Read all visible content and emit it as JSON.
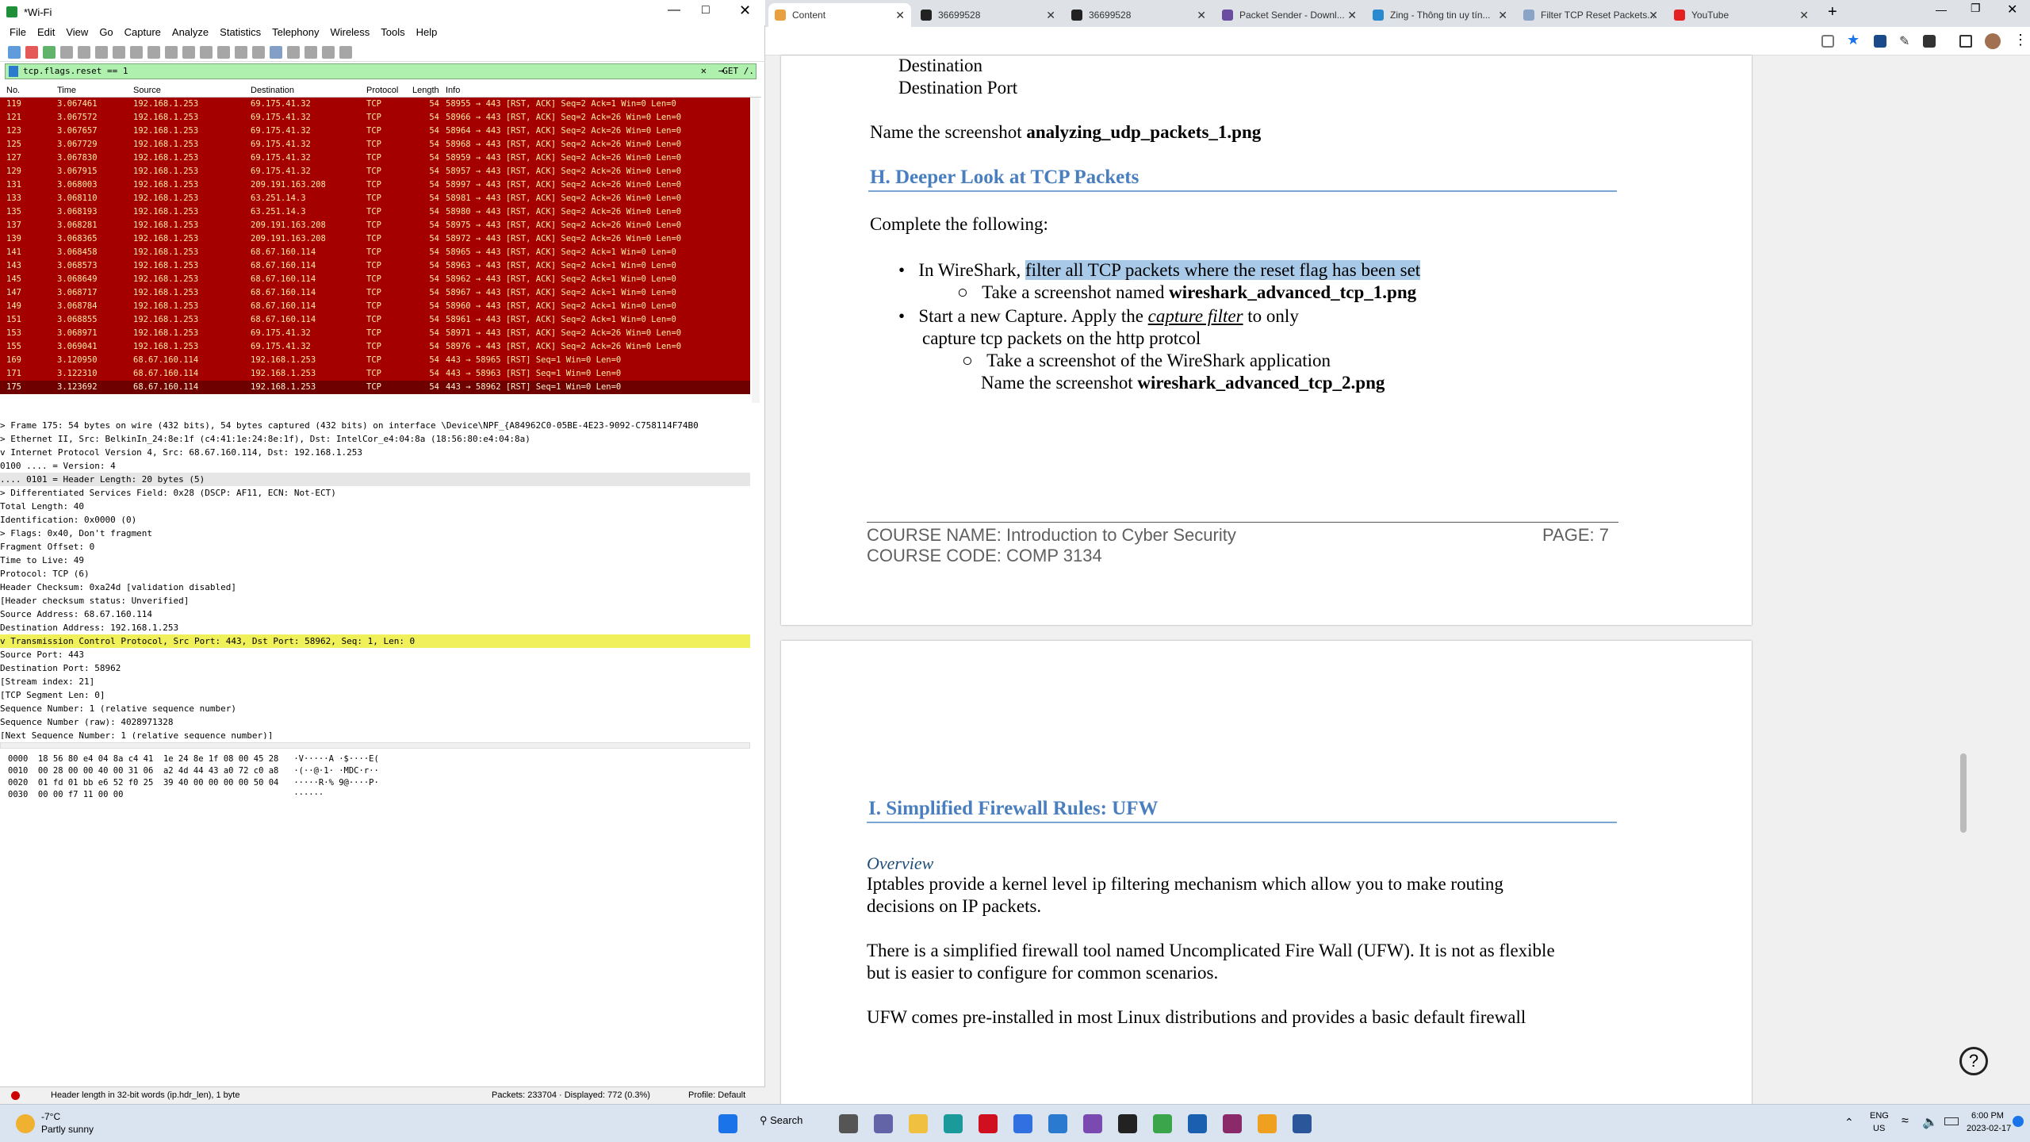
{
  "wireshark": {
    "title": "*Wi-Fi",
    "menu": [
      "File",
      "Edit",
      "View",
      "Go",
      "Capture",
      "Analyze",
      "Statistics",
      "Telephony",
      "Wireless",
      "Tools",
      "Help"
    ],
    "filter_value": "tcp.flags.reset == 1",
    "filter_expr": "GET /.",
    "columns": [
      "No.",
      "Time",
      "Source",
      "Destination",
      "Protocol",
      "Length",
      "Info"
    ],
    "packets": [
      [
        "119",
        "3.067461",
        "192.168.1.253",
        "69.175.41.32",
        "TCP",
        "54",
        "58955 → 443 [RST, ACK] Seq=2 Ack=1 Win=0 Len=0"
      ],
      [
        "121",
        "3.067572",
        "192.168.1.253",
        "69.175.41.32",
        "TCP",
        "54",
        "58966 → 443 [RST, ACK] Seq=2 Ack=26 Win=0 Len=0"
      ],
      [
        "123",
        "3.067657",
        "192.168.1.253",
        "69.175.41.32",
        "TCP",
        "54",
        "58964 → 443 [RST, ACK] Seq=2 Ack=26 Win=0 Len=0"
      ],
      [
        "125",
        "3.067729",
        "192.168.1.253",
        "69.175.41.32",
        "TCP",
        "54",
        "58968 → 443 [RST, ACK] Seq=2 Ack=26 Win=0 Len=0"
      ],
      [
        "127",
        "3.067830",
        "192.168.1.253",
        "69.175.41.32",
        "TCP",
        "54",
        "58959 → 443 [RST, ACK] Seq=2 Ack=26 Win=0 Len=0"
      ],
      [
        "129",
        "3.067915",
        "192.168.1.253",
        "69.175.41.32",
        "TCP",
        "54",
        "58957 → 443 [RST, ACK] Seq=2 Ack=26 Win=0 Len=0"
      ],
      [
        "131",
        "3.068003",
        "192.168.1.253",
        "209.191.163.208",
        "TCP",
        "54",
        "58997 → 443 [RST, ACK] Seq=2 Ack=26 Win=0 Len=0"
      ],
      [
        "133",
        "3.068110",
        "192.168.1.253",
        "63.251.14.3",
        "TCP",
        "54",
        "58981 → 443 [RST, ACK] Seq=2 Ack=26 Win=0 Len=0"
      ],
      [
        "135",
        "3.068193",
        "192.168.1.253",
        "63.251.14.3",
        "TCP",
        "54",
        "58980 → 443 [RST, ACK] Seq=2 Ack=26 Win=0 Len=0"
      ],
      [
        "137",
        "3.068281",
        "192.168.1.253",
        "209.191.163.208",
        "TCP",
        "54",
        "58975 → 443 [RST, ACK] Seq=2 Ack=26 Win=0 Len=0"
      ],
      [
        "139",
        "3.068365",
        "192.168.1.253",
        "209.191.163.208",
        "TCP",
        "54",
        "58972 → 443 [RST, ACK] Seq=2 Ack=26 Win=0 Len=0"
      ],
      [
        "141",
        "3.068458",
        "192.168.1.253",
        "68.67.160.114",
        "TCP",
        "54",
        "58965 → 443 [RST, ACK] Seq=2 Ack=1 Win=0 Len=0"
      ],
      [
        "143",
        "3.068573",
        "192.168.1.253",
        "68.67.160.114",
        "TCP",
        "54",
        "58963 → 443 [RST, ACK] Seq=2 Ack=1 Win=0 Len=0"
      ],
      [
        "145",
        "3.068649",
        "192.168.1.253",
        "68.67.160.114",
        "TCP",
        "54",
        "58962 → 443 [RST, ACK] Seq=2 Ack=1 Win=0 Len=0"
      ],
      [
        "147",
        "3.068717",
        "192.168.1.253",
        "68.67.160.114",
        "TCP",
        "54",
        "58967 → 443 [RST, ACK] Seq=2 Ack=1 Win=0 Len=0"
      ],
      [
        "149",
        "3.068784",
        "192.168.1.253",
        "68.67.160.114",
        "TCP",
        "54",
        "58960 → 443 [RST, ACK] Seq=2 Ack=1 Win=0 Len=0"
      ],
      [
        "151",
        "3.068855",
        "192.168.1.253",
        "68.67.160.114",
        "TCP",
        "54",
        "58961 → 443 [RST, ACK] Seq=2 Ack=1 Win=0 Len=0"
      ],
      [
        "153",
        "3.068971",
        "192.168.1.253",
        "69.175.41.32",
        "TCP",
        "54",
        "58971 → 443 [RST, ACK] Seq=2 Ack=26 Win=0 Len=0"
      ],
      [
        "155",
        "3.069041",
        "192.168.1.253",
        "69.175.41.32",
        "TCP",
        "54",
        "58976 → 443 [RST, ACK] Seq=2 Ack=26 Win=0 Len=0"
      ],
      [
        "169",
        "3.120950",
        "68.67.160.114",
        "192.168.1.253",
        "TCP",
        "54",
        "443 → 58965 [RST] Seq=1 Win=0 Len=0"
      ],
      [
        "171",
        "3.122310",
        "68.67.160.114",
        "192.168.1.253",
        "TCP",
        "54",
        "443 → 58963 [RST] Seq=1 Win=0 Len=0"
      ],
      [
        "175",
        "3.123692",
        "68.67.160.114",
        "192.168.1.253",
        "TCP",
        "54",
        "443 → 58962 [RST] Seq=1 Win=0 Len=0"
      ]
    ],
    "details": [
      {
        "t": "> Frame 175: 54 bytes on wire (432 bits), 54 bytes captured (432 bits) on interface \\Device\\NPF_{A84962C0-05BE-4E23-9092-C758114F74B0",
        "c": ""
      },
      {
        "t": "> Ethernet II, Src: BelkinIn_24:8e:1f (c4:41:1e:24:8e:1f), Dst: IntelCor_e4:04:8a (18:56:80:e4:04:8a)",
        "c": ""
      },
      {
        "t": "v Internet Protocol Version 4, Src: 68.67.160.114, Dst: 192.168.1.253",
        "c": ""
      },
      {
        "t": "    0100 .... = Version: 4",
        "c": ""
      },
      {
        "t": "    .... 0101 = Header Length: 20 bytes (5)",
        "c": "hl"
      },
      {
        "t": "  > Differentiated Services Field: 0x28 (DSCP: AF11, ECN: Not-ECT)",
        "c": ""
      },
      {
        "t": "    Total Length: 40",
        "c": ""
      },
      {
        "t": "    Identification: 0x0000 (0)",
        "c": ""
      },
      {
        "t": "  > Flags: 0x40, Don't fragment",
        "c": ""
      },
      {
        "t": "    Fragment Offset: 0",
        "c": ""
      },
      {
        "t": "    Time to Live: 49",
        "c": ""
      },
      {
        "t": "    Protocol: TCP (6)",
        "c": ""
      },
      {
        "t": "    Header Checksum: 0xa24d [validation disabled]",
        "c": ""
      },
      {
        "t": "    [Header checksum status: Unverified]",
        "c": ""
      },
      {
        "t": "    Source Address: 68.67.160.114",
        "c": ""
      },
      {
        "t": "    Destination Address: 192.168.1.253",
        "c": ""
      },
      {
        "t": "v Transmission Control Protocol, Src Port: 443, Dst Port: 58962, Seq: 1, Len: 0",
        "c": "ylw"
      },
      {
        "t": "    Source Port: 443",
        "c": ""
      },
      {
        "t": "    Destination Port: 58962",
        "c": ""
      },
      {
        "t": "    [Stream index: 21]",
        "c": ""
      },
      {
        "t": "    [TCP Segment Len: 0]",
        "c": ""
      },
      {
        "t": "    Sequence Number: 1    (relative sequence number)",
        "c": ""
      },
      {
        "t": "    Sequence Number (raw): 4028971328",
        "c": ""
      },
      {
        "t": "    [Next Sequence Number: 1    (relative sequence number)]",
        "c": ""
      }
    ],
    "hex": [
      "0000  18 56 80 e4 04 8a c4 41  1e 24 8e 1f 08 00 45 28   ·V·····A ·$····E(",
      "0010  00 28 00 00 40 00 31 06  a2 4d 44 43 a0 72 c0 a8   ·(··@·1· ·MDC·r··",
      "0020  01 fd 01 bb e6 52 f0 25  39 40 00 00 00 00 50 04   ·····R·% 9@····P·",
      "0030  00 00 f7 11 00 00                                  ······"
    ],
    "status_field": "Header length in 32-bit words (ip.hdr_len), 1 byte",
    "status_packets": "Packets: 233704 · Displayed: 772 (0.3%)",
    "status_profile": "Profile: Default"
  },
  "browser": {
    "tabs": [
      "Content",
      "36699528",
      "36699528",
      "Packet Sender - Downl...",
      "Zing - Thông tin uy tín...",
      "Filter TCP Reset Packets...",
      "YouTube"
    ]
  },
  "doc": {
    "top_line1": "Destination",
    "top_line2": "Destination Port",
    "name_prefix": "Name the screenshot ",
    "name_bold": "analyzing_udp_packets_1.png",
    "section_h": "H. Deeper Look at TCP Packets",
    "complete": "Complete the following:",
    "b1_pre": "In WireShark, ",
    "b1_hl": "filter all TCP packets where the reset flag has been set",
    "b1_sub_pre": "Take a screenshot named ",
    "b1_sub_bold": "wireshark_advanced_tcp_1.png",
    "b2_pre": "Start a new Capture. Apply the ",
    "b2_em": "capture filter",
    "b2_post": " to only",
    "b2_line2": "capture tcp packets on the http protcol",
    "b2_sub1": "Take a screenshot of the WireShark application",
    "b2_sub2_pre": "Name the screenshot ",
    "b2_sub2_bold": "wireshark_advanced_tcp_2.png",
    "footer_course": "COURSE NAME: Introduction to Cyber Security",
    "footer_code": "COURSE CODE: COMP 3134",
    "footer_page": "PAGE: 7",
    "section_i": "I.  Simplified Firewall Rules: UFW",
    "overview": "Overview",
    "p1a": "Iptables provide a kernel level ip filtering mechanism which allow you to make routing",
    "p1b": "decisions on IP packets.",
    "p2a": "There is a simplified firewall tool named Uncomplicated Fire Wall (UFW). It is not as flexible",
    "p2b": "but is easier to configure for common scenarios.",
    "p3a": "UFW comes pre-installed in most Linux distributions and provides a basic default firewall"
  },
  "taskbar": {
    "temp": "-7°C",
    "weather": "Partly sunny",
    "search": "Search",
    "lang1": "ENG",
    "lang2": "US",
    "time": "6:00 PM",
    "date": "2023-02-17"
  }
}
